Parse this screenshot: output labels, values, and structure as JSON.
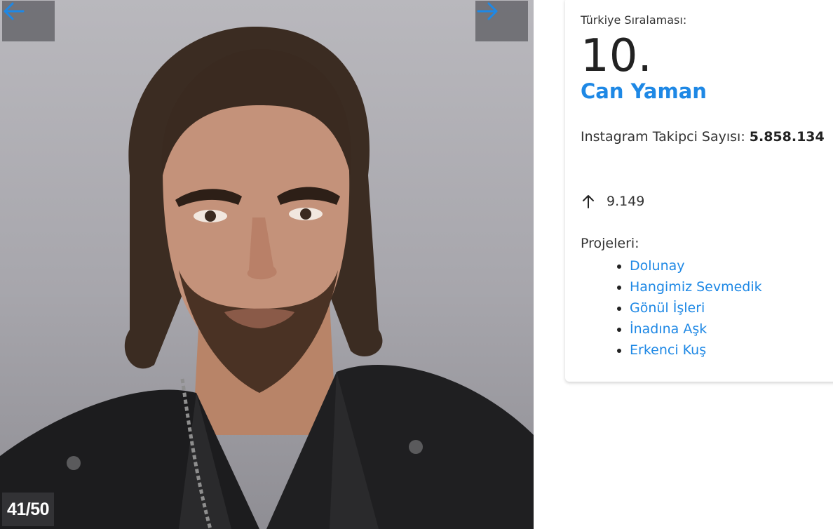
{
  "gallery": {
    "counter": "41/50",
    "prev_icon": "arrow-left-icon",
    "next_icon": "arrow-right-icon",
    "accent_color": "#1e88e5"
  },
  "profile": {
    "rank_label": "Türkiye Sıralaması:",
    "rank": "10.",
    "name": "Can Yaman",
    "followers_label": "Instagram Takipci Sayısı:",
    "followers_value": "5.858.134",
    "change_icon": "arrow-up-icon",
    "change_value": "9.149",
    "projects_label": "Projeleri:",
    "projects": [
      "Dolunay",
      "Hangimiz Sevmedik",
      "Gönül İşleri",
      "İnadına Aşk",
      "Erkenci Kuş"
    ]
  }
}
